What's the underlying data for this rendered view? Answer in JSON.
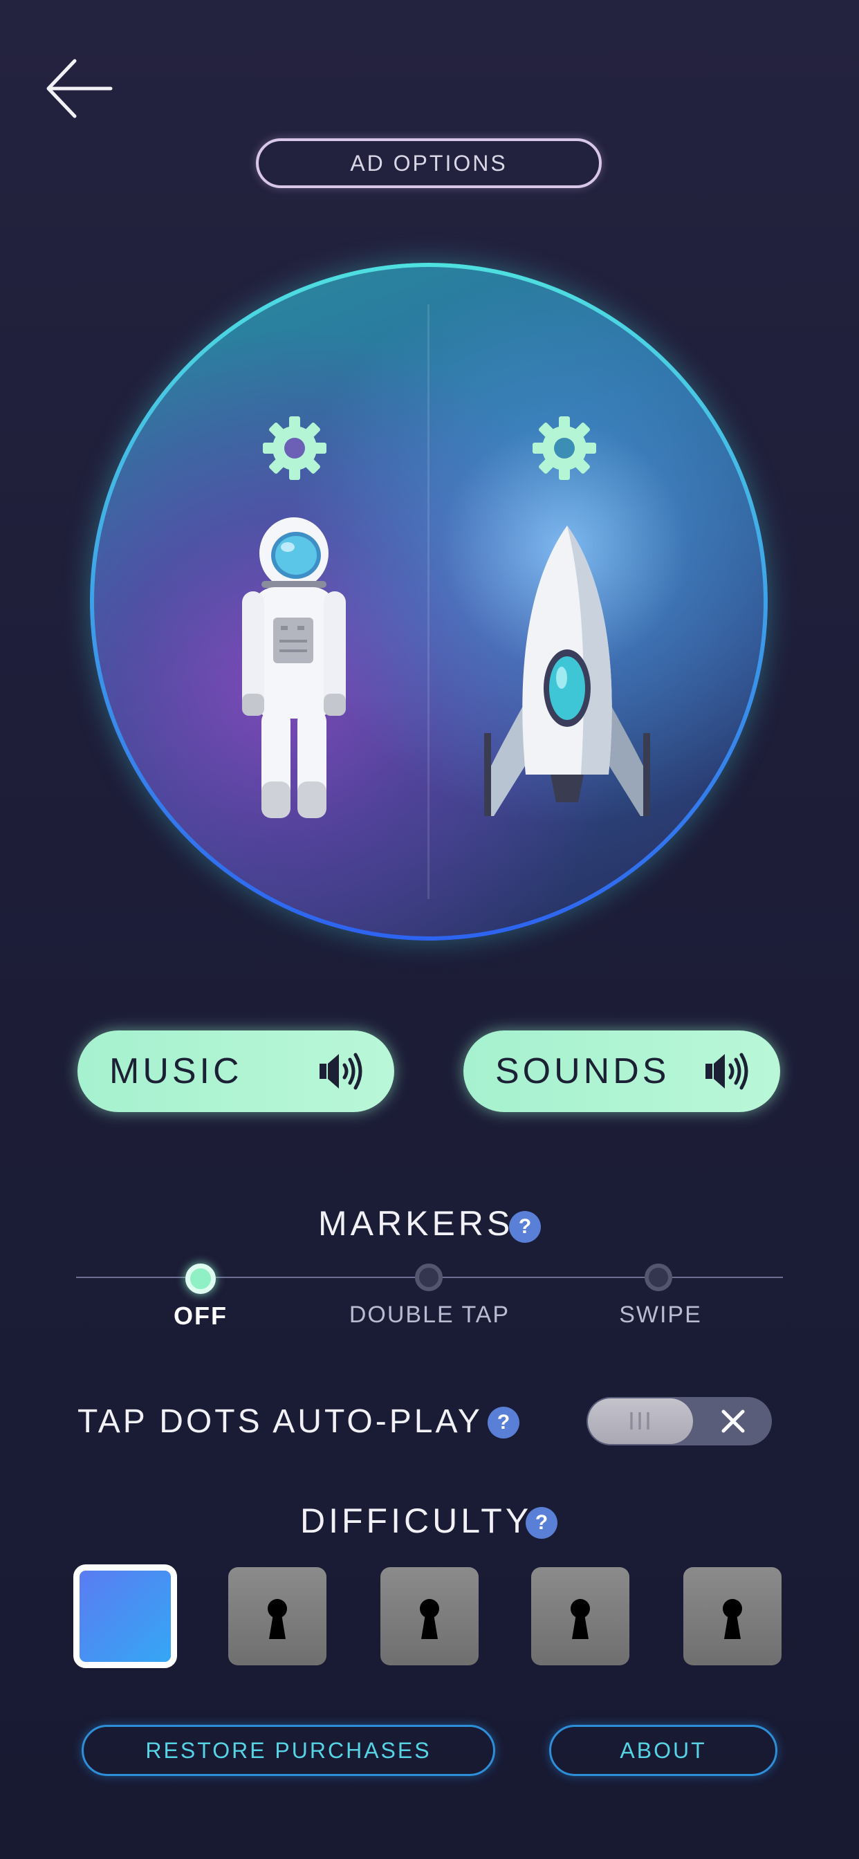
{
  "header": {
    "ad_options_label": "AD OPTIONS"
  },
  "characters": {
    "left": {
      "name": "astronaut",
      "icon": "gear-icon"
    },
    "right": {
      "name": "rocket",
      "icon": "gear-icon"
    }
  },
  "audio": {
    "music_label": "MUSIC",
    "sounds_label": "SOUNDS",
    "music_icon": "speaker-on-icon",
    "sounds_icon": "speaker-on-icon"
  },
  "markers": {
    "title": "MARKERS",
    "help": "?",
    "options": [
      "OFF",
      "DOUBLE TAP",
      "SWIPE"
    ],
    "selected": "OFF"
  },
  "tap_dots": {
    "title": "TAP DOTS AUTO-PLAY",
    "help": "?",
    "toggle_knob": "III",
    "enabled": false
  },
  "difficulty": {
    "title": "DIFFICULTY",
    "help": "?",
    "levels": [
      {
        "locked": false,
        "selected": true
      },
      {
        "locked": true
      },
      {
        "locked": true
      },
      {
        "locked": true
      },
      {
        "locked": true
      }
    ]
  },
  "footer": {
    "restore_label": "RESTORE PURCHASES",
    "about_label": "ABOUT"
  },
  "colors": {
    "accent_mint": "#b9f7d8",
    "ring_cyan": "#4fe0e0",
    "ring_blue": "#2d63f0",
    "help_blue": "#5a7fd6",
    "button_text_cyan": "#56d4e6"
  }
}
